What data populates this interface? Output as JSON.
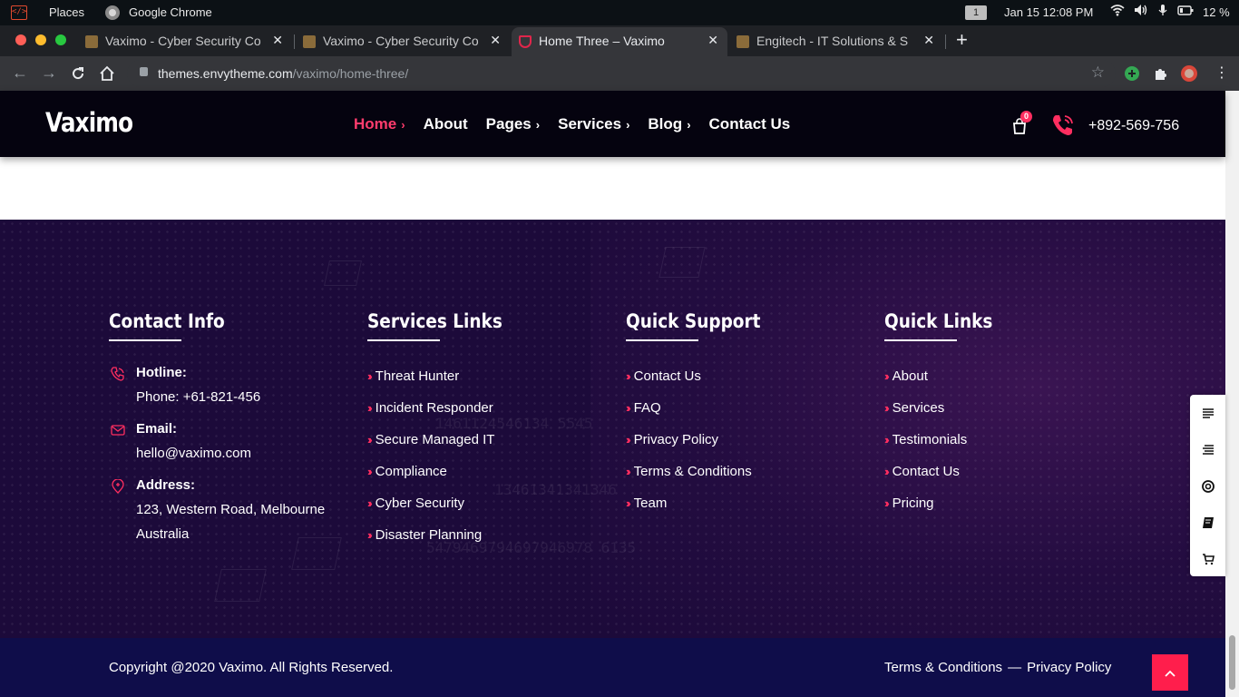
{
  "os": {
    "places": "Places",
    "chrome": "Google Chrome",
    "workspace": "1",
    "datetime": "Jan 15  12:08 PM",
    "battery": "12 %"
  },
  "tabs": [
    {
      "title": "Vaximo - Cyber Security Co",
      "active": false
    },
    {
      "title": "Vaximo - Cyber Security Co",
      "active": false
    },
    {
      "title": "Home Three – Vaximo",
      "active": true
    },
    {
      "title": "Engitech - IT Solutions & S",
      "active": false
    }
  ],
  "address": {
    "host": "themes.envytheme.com",
    "path": "/vaximo/home-three/"
  },
  "header": {
    "logo": "Vaximo",
    "nav": [
      {
        "label": "Home",
        "chevron": true
      },
      {
        "label": "About",
        "chevron": false
      },
      {
        "label": "Pages",
        "chevron": true
      },
      {
        "label": "Services",
        "chevron": true
      },
      {
        "label": "Blog",
        "chevron": true
      },
      {
        "label": "Contact Us",
        "chevron": false
      }
    ],
    "cart_count": "0",
    "phone": "+892-569-756"
  },
  "footer": {
    "contact": {
      "title": "Contact Info",
      "hotline_label": "Hotline:",
      "hotline_value": "Phone: +61-821-456",
      "email_label": "Email:",
      "email_value": "hello@vaximo.com",
      "address_label": "Address:",
      "address_line1": "123, Western Road, Melbourne",
      "address_line2": "Australia"
    },
    "services": {
      "title": "Services Links",
      "items": [
        "Threat Hunter",
        "Incident Responder",
        "Secure Managed IT",
        "Compliance",
        "Cyber Security",
        "Disaster Planning"
      ]
    },
    "support": {
      "title": "Quick Support",
      "items": [
        "Contact Us",
        "FAQ",
        "Privacy Policy",
        "Terms & Conditions",
        "Team"
      ]
    },
    "quick": {
      "title": "Quick Links",
      "items": [
        "About",
        "Services",
        "Testimonials",
        "Contact Us",
        "Pricing"
      ]
    }
  },
  "copyright": {
    "text": "Copyright @2020 Vaximo. All Rights Reserved.",
    "terms": "Terms & Conditions",
    "dash": "—",
    "privacy": "Privacy Policy"
  },
  "colors": {
    "accent": "#ff2e60",
    "header_bg": "#05030f",
    "footer_bg": "#1c0a3a",
    "copybar_bg": "#0f0d4a"
  }
}
